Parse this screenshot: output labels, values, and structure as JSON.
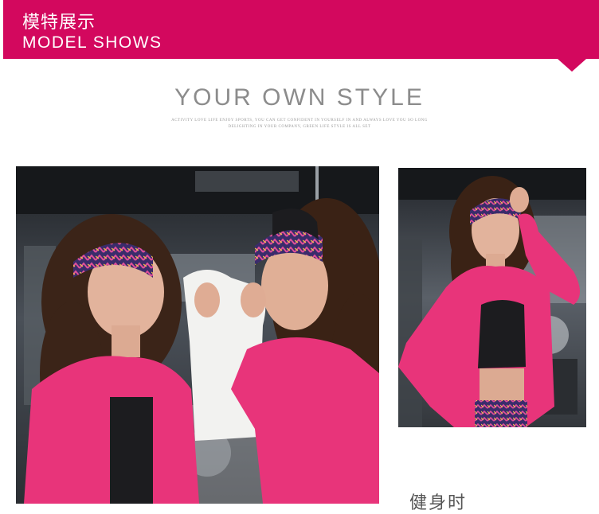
{
  "header": {
    "title_cn": "模特展示",
    "title_en": "MODEL SHOWS",
    "bg_color": "#d3085e"
  },
  "section": {
    "title": "YOUR OWN STYLE",
    "subtitle_line1": "ACTIVITY LOVE LIFE ENJOY SPORTS, YOU CAN GET CONFIDENT IN YOURSELF IN AND ALWAYS LOVE YOU SO LONG",
    "subtitle_line2": "DELIGHTING IN YOUR COMPANY, GREEN LIFE STYLE IS ALL SET"
  },
  "photos": [
    {
      "name": "model-photo-left",
      "description_icon": "photo-icon"
    },
    {
      "name": "model-photo-right",
      "description_icon": "photo-icon"
    }
  ],
  "caption": {
    "text": "健身时"
  },
  "colors": {
    "accent": "#d3085e",
    "jacket_pink": "#e8347a"
  }
}
